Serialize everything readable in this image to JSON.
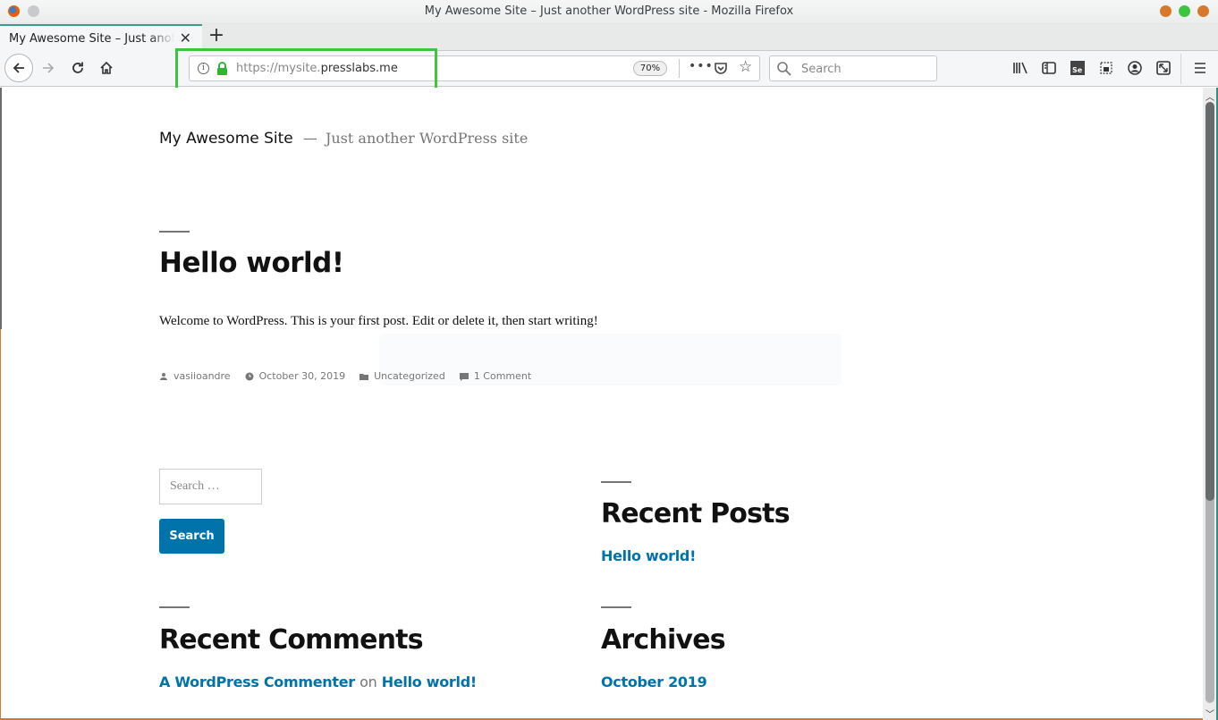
{
  "window": {
    "title": "My Awesome Site – Just another WordPress site - Mozilla Firefox",
    "controls": {
      "minimize_color": "#d6792c",
      "maximize_color": "#3ec43e",
      "close_color": "#d6792c"
    }
  },
  "tabs": [
    {
      "title": "My Awesome Site – Just another WordPress site",
      "active": true
    }
  ],
  "new_tab_label": "+",
  "toolbar": {
    "back_icon": "arrow-left-icon",
    "forward_icon": "arrow-right-icon",
    "reload_icon": "reload-icon",
    "home_icon": "home-icon",
    "url_scheme": "https://mysite.",
    "url_host": "presslabs.me",
    "zoom_level": "70%",
    "page_actions_label": "•••",
    "search_placeholder": "Search",
    "right_icons": [
      "library-icon",
      "sidebar-icon",
      "selenium-ide-icon",
      "screenshot-icon",
      "account-icon",
      "resize-icon",
      "menu-icon"
    ]
  },
  "highlight_color": "#3ec43e",
  "page": {
    "site_title": "My Awesome Site",
    "site_separator": "—",
    "site_description": "Just another WordPress site",
    "post": {
      "title": "Hello world!",
      "body": "Welcome to WordPress. This is your first post. Edit or delete it, then start writing!",
      "meta": {
        "author": "vasiioandre",
        "date": "October 30, 2019",
        "category": "Uncategorized",
        "comments": "1 Comment"
      }
    },
    "search_widget": {
      "placeholder": "Search …",
      "button_label": "Search"
    },
    "recent_posts": {
      "title": "Recent Posts",
      "items": [
        "Hello world!"
      ]
    },
    "recent_comments": {
      "title": "Recent Comments",
      "author": "A WordPress Commenter",
      "connector": "on",
      "post": "Hello world!"
    },
    "archives": {
      "title": "Archives",
      "items": [
        "October 2019"
      ]
    },
    "link_color": "#0073aa",
    "button_color": "#0073aa"
  }
}
